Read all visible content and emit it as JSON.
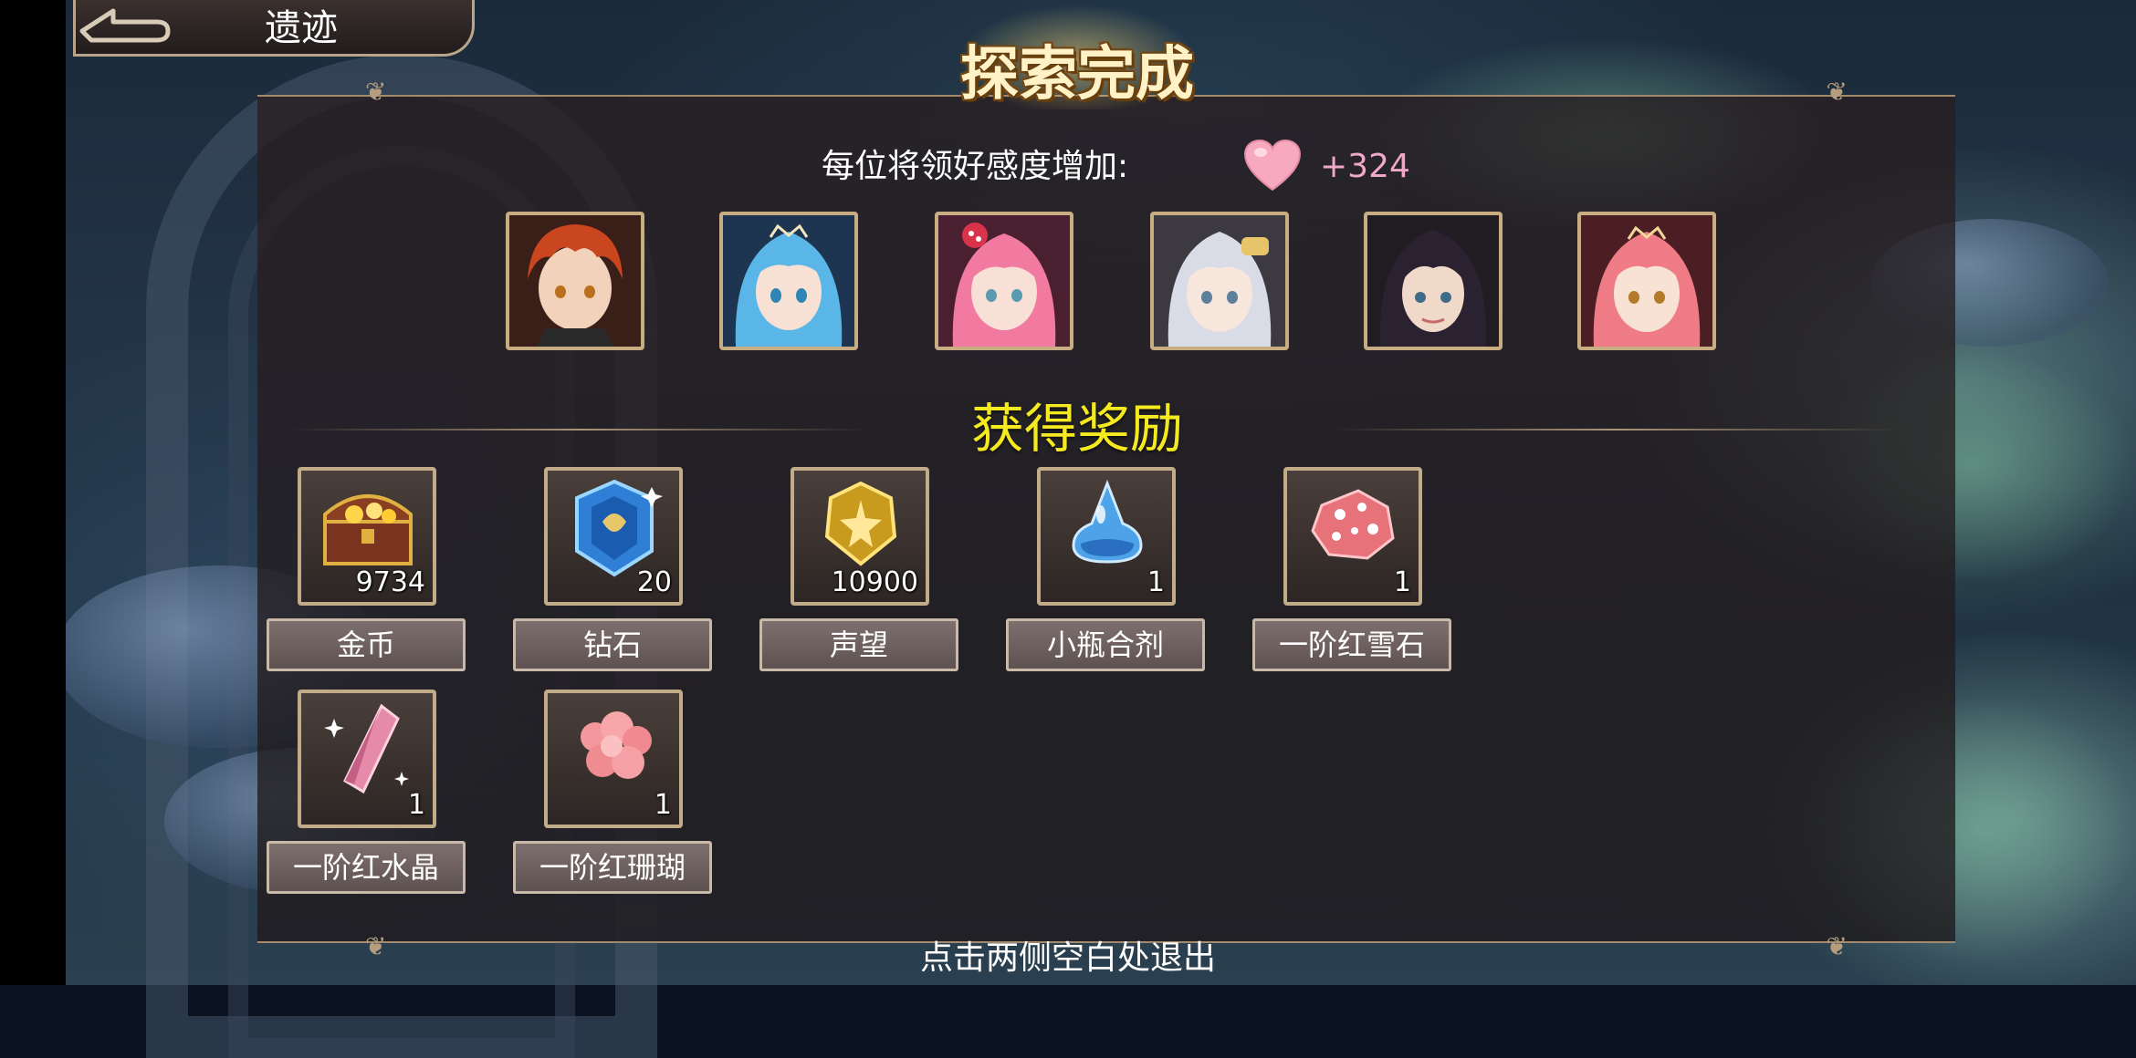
{
  "nav": {
    "title": "遗迹",
    "back_icon": "back-arrow-icon"
  },
  "header": {
    "title": "探索完成"
  },
  "affection": {
    "label": "每位将领好感度增加:",
    "value": "+324",
    "icon": "heart-icon",
    "heart_color": "#f7a9bf"
  },
  "heroes": [
    {
      "name": "hero-portrait-1",
      "hair": "#c9461f"
    },
    {
      "name": "hero-portrait-2",
      "hair": "#5ab6e6"
    },
    {
      "name": "hero-portrait-3",
      "hair": "#f27aa0"
    },
    {
      "name": "hero-portrait-4",
      "hair": "#d9dbe6"
    },
    {
      "name": "hero-portrait-5",
      "hair": "#2a2230"
    },
    {
      "name": "hero-portrait-6",
      "hair": "#ef7b86"
    }
  ],
  "rewards": {
    "title": "获得奖励",
    "title_color": "#f4ea1f",
    "items": [
      {
        "label": "金币",
        "count": "9734",
        "icon": "treasure-chest-icon"
      },
      {
        "label": "钻石",
        "count": "20",
        "icon": "diamond-crest-icon"
      },
      {
        "label": "声望",
        "count": "10900",
        "icon": "prestige-badge-icon"
      },
      {
        "label": "小瓶合剂",
        "count": "1",
        "icon": "potion-bottle-icon"
      },
      {
        "label": "一阶红雪石",
        "count": "1",
        "icon": "red-snow-stone-icon"
      },
      {
        "label": "一阶红水晶",
        "count": "1",
        "icon": "red-crystal-icon"
      },
      {
        "label": "一阶红珊瑚",
        "count": "1",
        "icon": "red-coral-icon"
      }
    ]
  },
  "footer": {
    "hint": "点击两侧空白处退出"
  }
}
